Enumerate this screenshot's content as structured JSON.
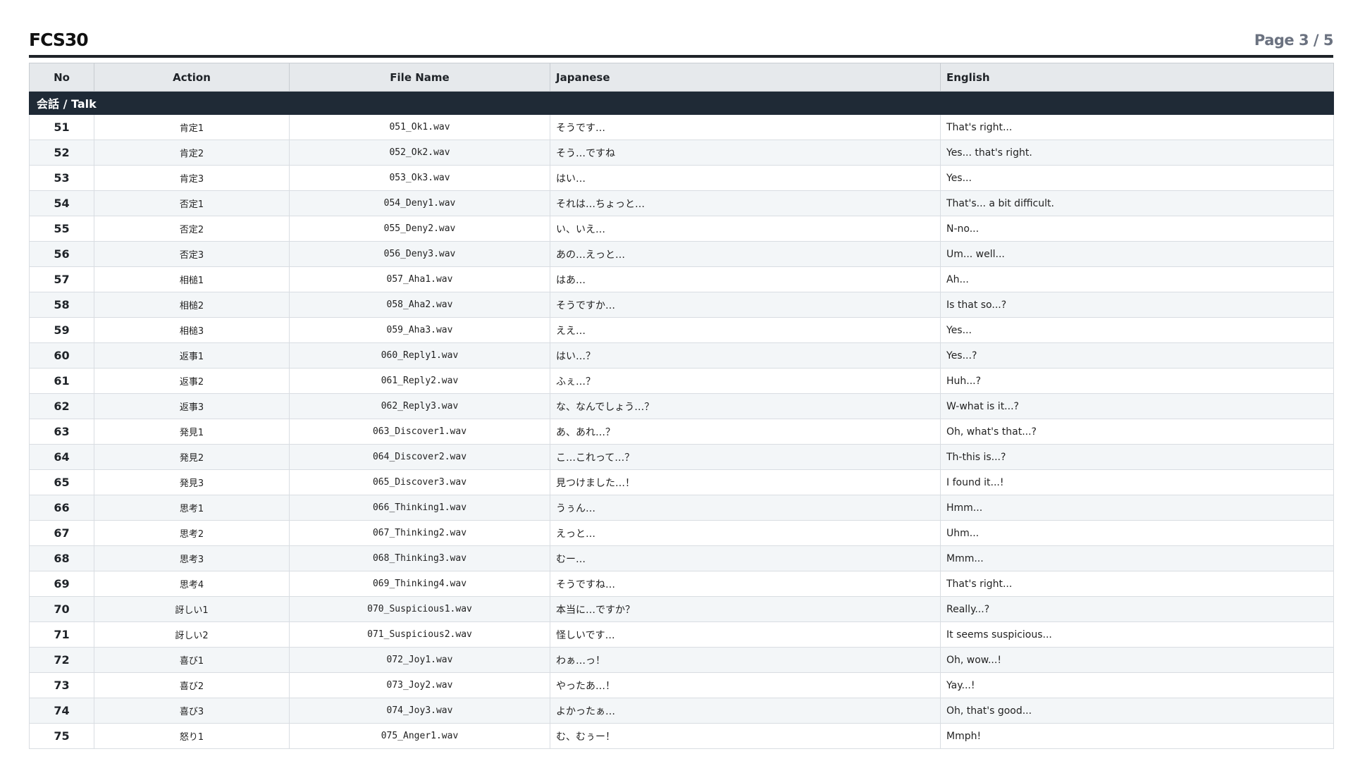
{
  "header": {
    "title": "FCS30",
    "page_label": "Page 3 / 5"
  },
  "columns": {
    "no": "No",
    "action": "Action",
    "file": "File Name",
    "japanese": "Japanese",
    "english": "English"
  },
  "section": {
    "label": "会話 / Talk"
  },
  "rows": [
    {
      "no": "51",
      "action": "肯定1",
      "file": "051_Ok1.wav",
      "ja": "そうです…",
      "en": "That's right..."
    },
    {
      "no": "52",
      "action": "肯定2",
      "file": "052_Ok2.wav",
      "ja": "そう…ですね",
      "en": "Yes... that's right."
    },
    {
      "no": "53",
      "action": "肯定3",
      "file": "053_Ok3.wav",
      "ja": "はい…",
      "en": "Yes..."
    },
    {
      "no": "54",
      "action": "否定1",
      "file": "054_Deny1.wav",
      "ja": "それは…ちょっと…",
      "en": "That's... a bit difficult."
    },
    {
      "no": "55",
      "action": "否定2",
      "file": "055_Deny2.wav",
      "ja": "い、いえ…",
      "en": "N-no..."
    },
    {
      "no": "56",
      "action": "否定3",
      "file": "056_Deny3.wav",
      "ja": "あの…えっと…",
      "en": "Um... well..."
    },
    {
      "no": "57",
      "action": "相槌1",
      "file": "057_Aha1.wav",
      "ja": "はあ…",
      "en": "Ah..."
    },
    {
      "no": "58",
      "action": "相槌2",
      "file": "058_Aha2.wav",
      "ja": "そうですか…",
      "en": "Is that so...?"
    },
    {
      "no": "59",
      "action": "相槌3",
      "file": "059_Aha3.wav",
      "ja": "ええ…",
      "en": "Yes..."
    },
    {
      "no": "60",
      "action": "返事1",
      "file": "060_Reply1.wav",
      "ja": "はい…？",
      "en": "Yes...?"
    },
    {
      "no": "61",
      "action": "返事2",
      "file": "061_Reply2.wav",
      "ja": "ふぇ…？",
      "en": "Huh...?"
    },
    {
      "no": "62",
      "action": "返事3",
      "file": "062_Reply3.wav",
      "ja": "な、なんでしょう…？",
      "en": "W-what is it...?"
    },
    {
      "no": "63",
      "action": "発見1",
      "file": "063_Discover1.wav",
      "ja": "あ、あれ…？",
      "en": "Oh, what's that...?"
    },
    {
      "no": "64",
      "action": "発見2",
      "file": "064_Discover2.wav",
      "ja": "こ…これって…？",
      "en": "Th-this is...?"
    },
    {
      "no": "65",
      "action": "発見3",
      "file": "065_Discover3.wav",
      "ja": "見つけました…！",
      "en": "I found it...!"
    },
    {
      "no": "66",
      "action": "思考1",
      "file": "066_Thinking1.wav",
      "ja": "うぅん…",
      "en": "Hmm..."
    },
    {
      "no": "67",
      "action": "思考2",
      "file": "067_Thinking2.wav",
      "ja": "えっと…",
      "en": "Uhm..."
    },
    {
      "no": "68",
      "action": "思考3",
      "file": "068_Thinking3.wav",
      "ja": "むー…",
      "en": "Mmm..."
    },
    {
      "no": "69",
      "action": "思考4",
      "file": "069_Thinking4.wav",
      "ja": "そうですね…",
      "en": "That's right..."
    },
    {
      "no": "70",
      "action": "訝しい1",
      "file": "070_Suspicious1.wav",
      "ja": "本当に…ですか？",
      "en": "Really...?"
    },
    {
      "no": "71",
      "action": "訝しい2",
      "file": "071_Suspicious2.wav",
      "ja": "怪しいです…",
      "en": "It seems suspicious..."
    },
    {
      "no": "72",
      "action": "喜び1",
      "file": "072_Joy1.wav",
      "ja": "わぁ…っ！",
      "en": "Oh, wow...!"
    },
    {
      "no": "73",
      "action": "喜び2",
      "file": "073_Joy2.wav",
      "ja": "やったあ…！",
      "en": "Yay...!"
    },
    {
      "no": "74",
      "action": "喜び3",
      "file": "074_Joy3.wav",
      "ja": "よかったぁ…",
      "en": "Oh, that's good..."
    },
    {
      "no": "75",
      "action": "怒り1",
      "file": "075_Anger1.wav",
      "ja": "む、むぅー！",
      "en": "Mmph!"
    }
  ]
}
